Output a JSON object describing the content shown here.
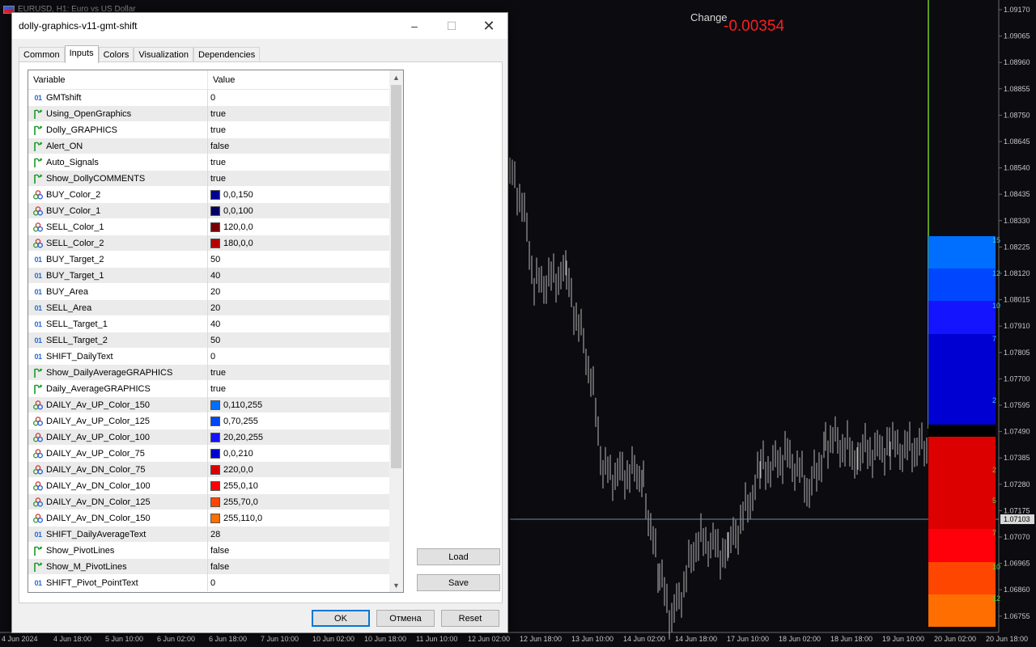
{
  "chart": {
    "caption": "EURUSD, H1: Euro vs US Dollar",
    "change_label": "Change",
    "change_value": "-0.00354",
    "current_price": "1.07103",
    "price_axis": [
      "1.09170",
      "1.09065",
      "1.08960",
      "1.08855",
      "1.08750",
      "1.08645",
      "1.08540",
      "1.08435",
      "1.08330",
      "1.08225",
      "1.08120",
      "1.08015",
      "1.07910",
      "1.07805",
      "1.07700",
      "1.07595",
      "1.07490",
      "1.07385",
      "1.07280",
      "1.07175",
      "1.07070",
      "1.06965",
      "1.06860",
      "1.06755"
    ],
    "time_axis": [
      "4 Jun 2024",
      "4 Jun 18:00",
      "5 Jun 10:00",
      "6 Jun 02:00",
      "6 Jun 18:00",
      "7 Jun 10:00",
      "10 Jun 02:00",
      "10 Jun 18:00",
      "11 Jun 10:00",
      "12 Jun 02:00",
      "12 Jun 18:00",
      "13 Jun 10:00",
      "14 Jun 02:00",
      "14 Jun 18:00",
      "17 Jun 10:00",
      "18 Jun 02:00",
      "18 Jun 18:00",
      "19 Jun 10:00",
      "20 Jun 02:00",
      "20 Jun 18:00"
    ],
    "side_labels": [
      "15",
      "12",
      "10",
      "7",
      "2",
      "2",
      "5",
      "7",
      "10",
      "12"
    ],
    "colors": {
      "background": "#0b0b10",
      "candle": "#b8b8b8",
      "green_line": "#7ccc1c",
      "change_value": "#ff1e1e"
    }
  },
  "dialog": {
    "title": "dolly-graphics-v11-gmt-shift",
    "tabs": [
      {
        "label": "Common",
        "active": false
      },
      {
        "label": "Inputs",
        "active": true
      },
      {
        "label": "Colors",
        "active": false
      },
      {
        "label": "Visualization",
        "active": false
      },
      {
        "label": "Dependencies",
        "active": false
      }
    ],
    "columns": {
      "variable": "Variable",
      "value": "Value"
    },
    "rows": [
      {
        "type": "num",
        "icon_text": "01",
        "name": "GMTshift",
        "value": "0"
      },
      {
        "type": "bool",
        "name": "Using_OpenGraphics",
        "value": "true"
      },
      {
        "type": "bool",
        "name": "Dolly_GRAPHICS",
        "value": "true"
      },
      {
        "type": "bool",
        "name": "Alert_ON",
        "value": "false"
      },
      {
        "type": "bool",
        "name": "Auto_Signals",
        "value": "true"
      },
      {
        "type": "bool",
        "name": "Show_DollyCOMMENTS",
        "value": "true"
      },
      {
        "type": "color",
        "name": "BUY_Color_2",
        "value": "0,0,150",
        "swatch": "#000096"
      },
      {
        "type": "color",
        "name": "BUY_Color_1",
        "value": "0,0,100",
        "swatch": "#000064"
      },
      {
        "type": "color",
        "name": "SELL_Color_1",
        "value": "120,0,0",
        "swatch": "#780000"
      },
      {
        "type": "color",
        "name": "SELL_Color_2",
        "value": "180,0,0",
        "swatch": "#b40000"
      },
      {
        "type": "num",
        "icon_text": "01",
        "name": "BUY_Target_2",
        "value": "50"
      },
      {
        "type": "num",
        "icon_text": "01",
        "name": "BUY_Target_1",
        "value": "40"
      },
      {
        "type": "num",
        "icon_text": "01",
        "name": "BUY_Area",
        "value": "20"
      },
      {
        "type": "num",
        "icon_text": "01",
        "name": "SELL_Area",
        "value": "20"
      },
      {
        "type": "num",
        "icon_text": "01",
        "name": "SELL_Target_1",
        "value": "40"
      },
      {
        "type": "num",
        "icon_text": "01",
        "name": "SELL_Target_2",
        "value": "50"
      },
      {
        "type": "num",
        "icon_text": "01",
        "name": "SHIFT_DailyText",
        "value": "0"
      },
      {
        "type": "bool",
        "name": "Show_DailyAverageGRAPHICS",
        "value": "true"
      },
      {
        "type": "bool",
        "name": "Daily_AverageGRAPHICS",
        "value": "true"
      },
      {
        "type": "color",
        "name": "DAILY_Av_UP_Color_150",
        "value": "0,110,255",
        "swatch": "#006eff"
      },
      {
        "type": "color",
        "name": "DAILY_Av_UP_Color_125",
        "value": "0,70,255",
        "swatch": "#0046ff"
      },
      {
        "type": "color",
        "name": "DAILY_Av_UP_Color_100",
        "value": "20,20,255",
        "swatch": "#1414ff"
      },
      {
        "type": "color",
        "name": "DAILY_Av_UP_Color_75",
        "value": "0,0,210",
        "swatch": "#0000d2"
      },
      {
        "type": "color",
        "name": "DAILY_Av_DN_Color_75",
        "value": "220,0,0",
        "swatch": "#dc0000"
      },
      {
        "type": "color",
        "name": "DAILY_Av_DN_Color_100",
        "value": "255,0,10",
        "swatch": "#ff000a"
      },
      {
        "type": "color",
        "name": "DAILY_Av_DN_Color_125",
        "value": "255,70,0",
        "swatch": "#ff4600"
      },
      {
        "type": "color",
        "name": "DAILY_Av_DN_Color_150",
        "value": "255,110,0",
        "swatch": "#ff6e00"
      },
      {
        "type": "num",
        "icon_text": "01",
        "name": "SHIFT_DailyAverageText",
        "value": "28"
      },
      {
        "type": "bool",
        "name": "Show_PivotLines",
        "value": "false"
      },
      {
        "type": "bool",
        "name": "Show_M_PivotLines",
        "value": "false"
      },
      {
        "type": "num",
        "icon_text": "01",
        "name": "SHIFT_Pivot_PointText",
        "value": "0"
      }
    ],
    "buttons": {
      "load": "Load",
      "save": "Save",
      "ok": "OK",
      "cancel": "Отмена",
      "reset": "Reset"
    }
  }
}
